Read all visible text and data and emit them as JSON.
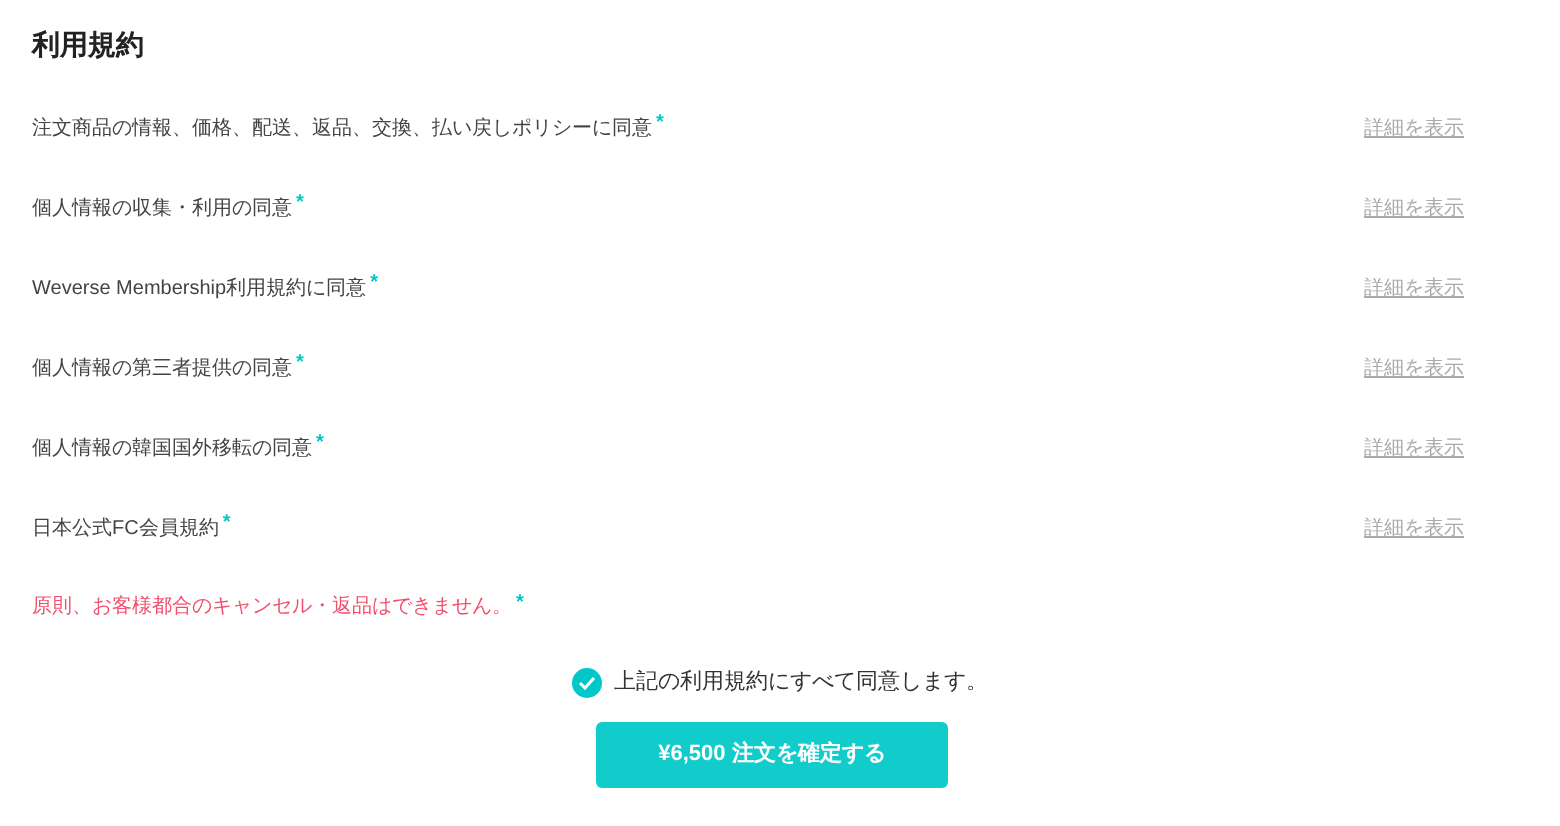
{
  "title": "利用規約",
  "terms": [
    {
      "label": "注文商品の情報、価格、配送、返品、交換、払い戻しポリシーに同意",
      "mark": "*",
      "link": "詳細を表示"
    },
    {
      "label": "個人情報の収集・利用の同意",
      "mark": "*",
      "link": "詳細を表示"
    },
    {
      "label": "Weverse Membership利用規約に同意",
      "mark": "*",
      "link": "詳細を表示"
    },
    {
      "label": "個人情報の第三者提供の同意",
      "mark": "*",
      "link": "詳細を表示"
    },
    {
      "label": "個人情報の韓国国外移転の同意",
      "mark": "*",
      "link": "詳細を表示"
    },
    {
      "label": "日本公式FC会員規約",
      "mark": "*",
      "link": "詳細を表示"
    }
  ],
  "notice": {
    "text": "原則、お客様都合のキャンセル・返品はできません。",
    "mark": "*"
  },
  "agree_all": {
    "label": "上記の利用規約にすべて同意します。",
    "checked": true
  },
  "confirm_button": "¥6,500 注文を確定する"
}
